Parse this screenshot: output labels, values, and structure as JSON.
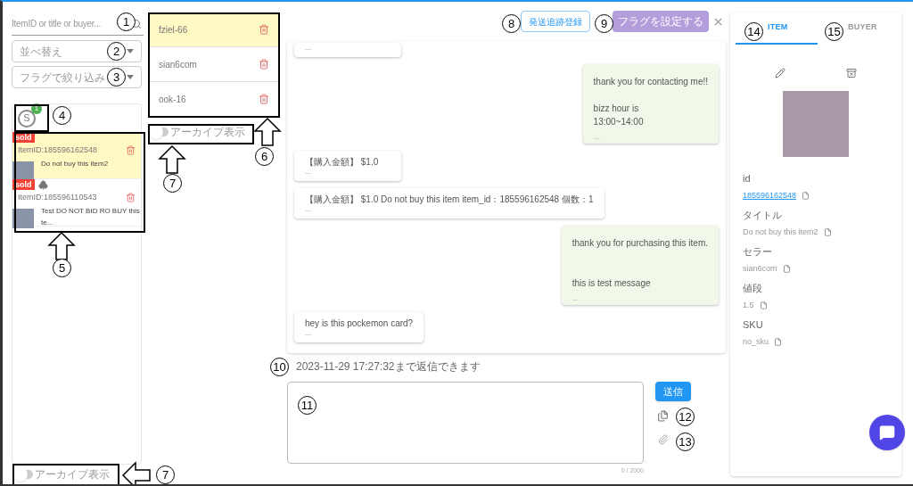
{
  "search": {
    "placeholder": "ItemID or title or buyer..."
  },
  "sort_select": {
    "placeholder": "並べ替え"
  },
  "flag_select": {
    "placeholder": "フラグで絞り込み"
  },
  "seller_tab": {
    "avatar": "S",
    "badge": "1",
    "selected": true
  },
  "items": [
    {
      "tag": "sold",
      "club": false,
      "item_id": "ItemID:185596162548",
      "title": "Do not buy this item2",
      "selected": true
    },
    {
      "tag": "sold",
      "club": true,
      "item_id": "ItemID:185596110543",
      "title": "Test DO NOT BID RO BUY this te...",
      "selected": false
    }
  ],
  "archive_toggle_items": {
    "label": "アーカイブ表示",
    "on": false
  },
  "buyers": [
    {
      "name": "fziel-66",
      "selected": true
    },
    {
      "name": "sian6com",
      "selected": false
    },
    {
      "name": "ook-16",
      "selected": false
    }
  ],
  "archive_toggle_buyers": {
    "label": "アーカイブ表示",
    "on": false
  },
  "header_buttons": {
    "tracking": "発送追跡登録",
    "flag": "フラグを設定する"
  },
  "messages": [
    {
      "kind": "buyer",
      "meta": "—"
    },
    {
      "kind": "seller",
      "text": "thank you for contacting me!!\n\nbizz hour is\n13:00~14:00",
      "meta": "—"
    },
    {
      "kind": "buyer",
      "text": "【購入金額】 $1.0",
      "meta": "—"
    },
    {
      "kind": "buyer",
      "text": "【購入金額】 $1.0 Do not buy this item item_id：185596162548 個数：1",
      "meta": "—"
    },
    {
      "kind": "seller",
      "text": "thank you for purchasing this item.\n\n\nthis is test message",
      "meta": "—"
    },
    {
      "kind": "buyer",
      "text": "hey is this pockemon card?",
      "meta": "—"
    }
  ],
  "reply_deadline": "2023-11-29 17:27:32まで返信できます",
  "reply": {
    "counter": "0 / 2000",
    "send": "送信"
  },
  "detail_tabs": [
    {
      "label": "ITEM",
      "selected": true
    },
    {
      "label": "BUYER",
      "selected": false
    }
  ],
  "fields": [
    {
      "label": "id",
      "value": "185596162548",
      "kind": "link"
    },
    {
      "label": "タイトル",
      "value": "Do not buy this item2",
      "kind": "text"
    },
    {
      "label": "セラー",
      "value": "sian6com",
      "kind": "text"
    },
    {
      "label": "値段",
      "value": "1.5",
      "kind": "text"
    },
    {
      "label": "SKU",
      "value": "no_sku",
      "kind": "text"
    }
  ],
  "annotations": [
    {
      "number": "1"
    },
    {
      "number": "2"
    },
    {
      "number": "3"
    },
    {
      "number": "4"
    },
    {
      "number": "5"
    },
    {
      "number": "6"
    },
    {
      "number": "7"
    },
    {
      "number": "8"
    },
    {
      "number": "9"
    },
    {
      "number": "10"
    },
    {
      "number": "11"
    },
    {
      "number": "12"
    },
    {
      "number": "13"
    },
    {
      "number": "14"
    },
    {
      "number": "15"
    },
    {
      "number": "7"
    }
  ]
}
